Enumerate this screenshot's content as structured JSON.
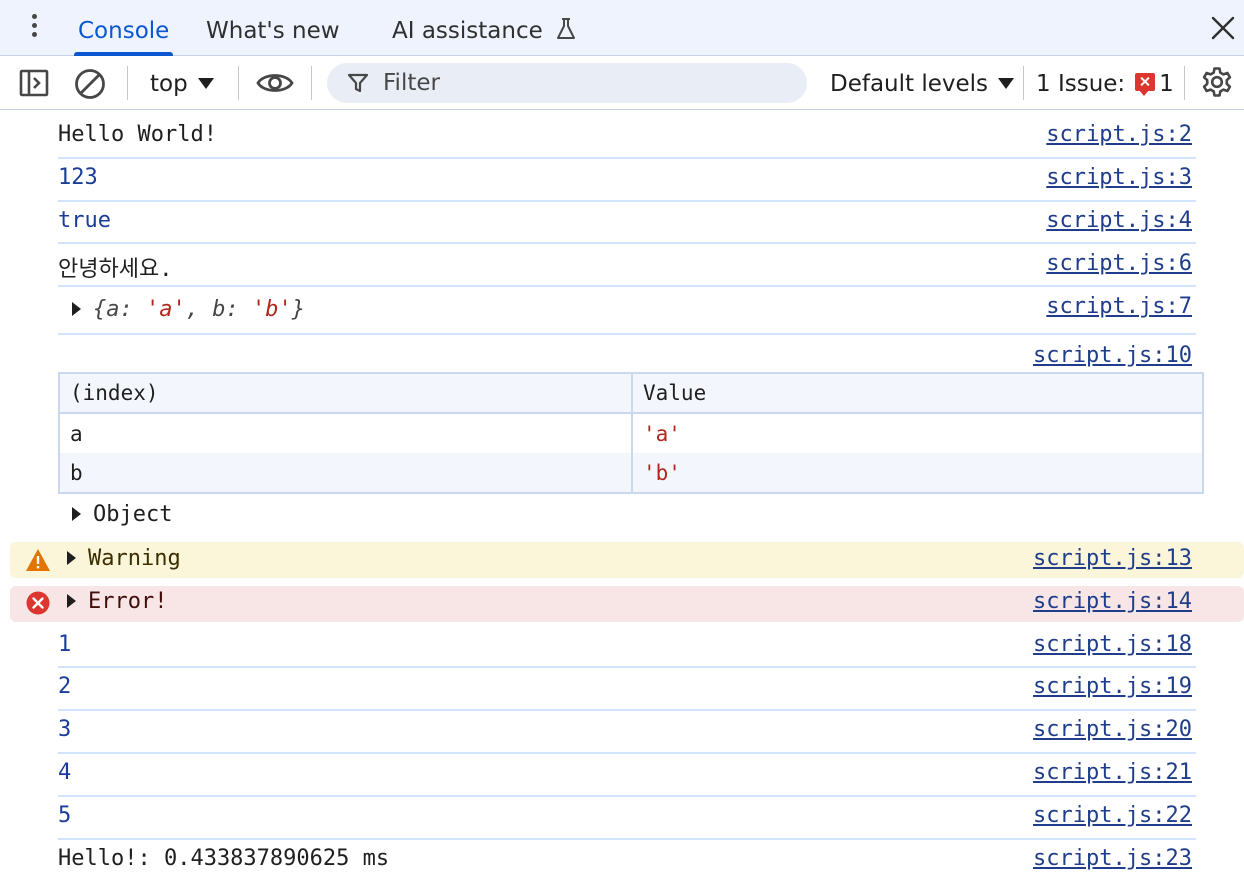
{
  "tabs": {
    "console": "Console",
    "whats_new": "What's new",
    "ai_assistance": "AI assistance"
  },
  "toolbar": {
    "context": "top",
    "filter_placeholder": "Filter",
    "levels": "Default levels",
    "issues_label": "1 Issue:",
    "issues_count": "1"
  },
  "console": {
    "rows": [
      {
        "text": "Hello World!",
        "src": "script.js:2"
      },
      {
        "text": "123",
        "src": "script.js:3"
      },
      {
        "text": "true",
        "src": "script.js:4"
      },
      {
        "text": "안녕하세요.",
        "src": "script.js:6"
      },
      {
        "src": "script.js:7"
      }
    ],
    "object_preview": {
      "open": "{",
      "k1": "a",
      "colon1": ": ",
      "v1": "'a'",
      "sep": ", ",
      "k2": "b",
      "colon2": ": ",
      "v2": "'b'",
      "close": "}"
    },
    "table": {
      "src": "script.js:10",
      "headers": [
        "(index)",
        "Value"
      ],
      "rows": [
        {
          "index": "a",
          "value": "'a'"
        },
        {
          "index": "b",
          "value": "'b'"
        }
      ],
      "object_label": "Object"
    },
    "warning": {
      "text": "Warning",
      "src": "script.js:13"
    },
    "error": {
      "text": "Error!",
      "src": "script.js:14"
    },
    "counts": [
      {
        "text": "1",
        "src": "script.js:18"
      },
      {
        "text": "2",
        "src": "script.js:19"
      },
      {
        "text": "3",
        "src": "script.js:20"
      },
      {
        "text": "4",
        "src": "script.js:21"
      },
      {
        "text": "5",
        "src": "script.js:22"
      }
    ],
    "timer": {
      "text": "Hello!: 0.433837890625 ms",
      "src": "script.js:23"
    }
  },
  "colors": {
    "accent": "#0b57d0",
    "number": "#1a3d99",
    "string": "#b3261e",
    "warning_bg": "#fbf5d9",
    "error_bg": "#f7e6e5"
  }
}
